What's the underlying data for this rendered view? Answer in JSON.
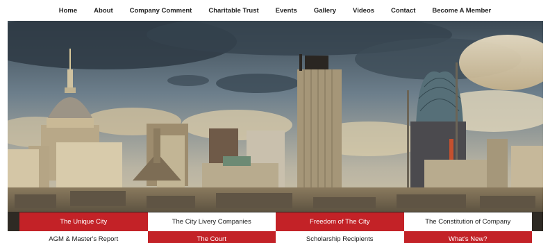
{
  "nav": {
    "items": [
      {
        "label": "Home"
      },
      {
        "label": "About"
      },
      {
        "label": "Company Comment"
      },
      {
        "label": "Charitable Trust"
      },
      {
        "label": "Events"
      },
      {
        "label": "Gallery"
      },
      {
        "label": "Videos"
      },
      {
        "label": "Contact"
      },
      {
        "label": "Become A Member"
      }
    ]
  },
  "hero": {
    "image": "london-city-skyline-photo"
  },
  "tiles": {
    "row1": [
      {
        "label": "The Unique City",
        "style": "red"
      },
      {
        "label": "The City Livery Companies",
        "style": "white"
      },
      {
        "label": "Freedom of The City",
        "style": "red"
      },
      {
        "label": "The Constitution of Company",
        "style": "white"
      }
    ],
    "row2": [
      {
        "label": "AGM & Master's Report",
        "style": "white"
      },
      {
        "label": "The Court",
        "style": "red"
      },
      {
        "label": "Scholarship Recipients",
        "style": "white"
      },
      {
        "label": "What's New?",
        "style": "red"
      }
    ]
  },
  "colors": {
    "accent_red": "#c32227",
    "nav_text": "#222222",
    "tile_white": "#ffffff"
  }
}
